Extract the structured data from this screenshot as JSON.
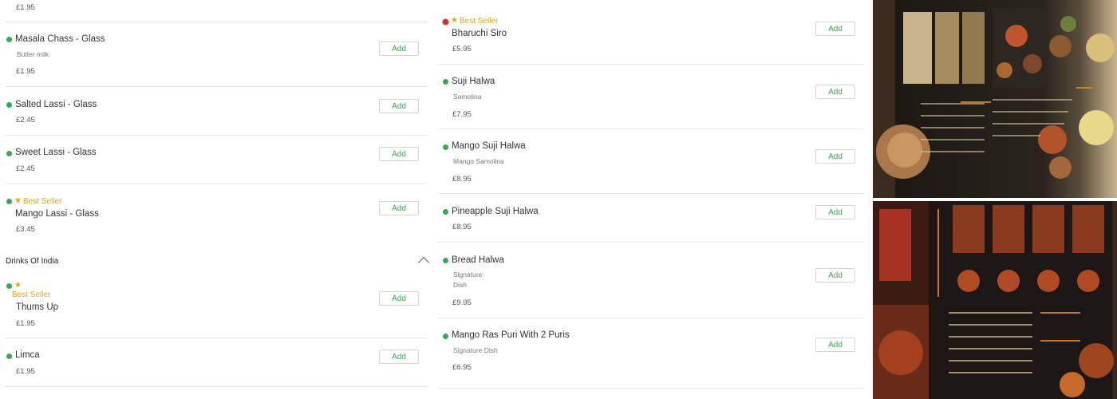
{
  "left": {
    "top_price": "£1.95",
    "items": [
      {
        "name": "Masala Chass - Glass",
        "desc": "Butter milk",
        "price": "£1.95",
        "add": "Add"
      },
      {
        "name": "Salted Lassi - Glass",
        "price": "£2.45",
        "add": "Add"
      },
      {
        "name": "Sweet Lassi - Glass",
        "price": "£2.45",
        "add": "Add"
      },
      {
        "badge": "Best Seller",
        "name": "Mango Lassi - Glass",
        "price": "£3.45",
        "add": "Add"
      }
    ],
    "section_title": "Drinks Of India",
    "drinks": [
      {
        "badge": "Best Seller",
        "name": "Thums Up",
        "price": "£1.95",
        "add": "Add"
      },
      {
        "name": "Limca",
        "price": "£1.95",
        "add": "Add"
      }
    ]
  },
  "mid": {
    "items": [
      {
        "badge": "Best Seller",
        "name": "Bharuchi Siro",
        "price": "£5.95",
        "add": "Add"
      },
      {
        "name": "Suji Halwa",
        "desc": "Samolina",
        "price": "£7.95",
        "add": "Add"
      },
      {
        "name": "Mango Suji Halwa",
        "desc": "Mango Samolina",
        "price": "£8.95",
        "add": "Add"
      },
      {
        "name": "Pineapple Suji Halwa",
        "price": "£8.95",
        "add": "Add"
      },
      {
        "name": "Bread Halwa",
        "desc1": "Signature",
        "desc2": "Dish",
        "price": "£9.95",
        "add": "Add"
      },
      {
        "name": "Mango Ras Puri With 2 Puris",
        "desc": "Signature Dish",
        "price": "£6.95",
        "add": "Add"
      }
    ]
  },
  "colors": {
    "veg": "#3aa757",
    "nonveg": "#c53030",
    "bestseller": "#e3a21a",
    "add_text": "#3aa757"
  }
}
